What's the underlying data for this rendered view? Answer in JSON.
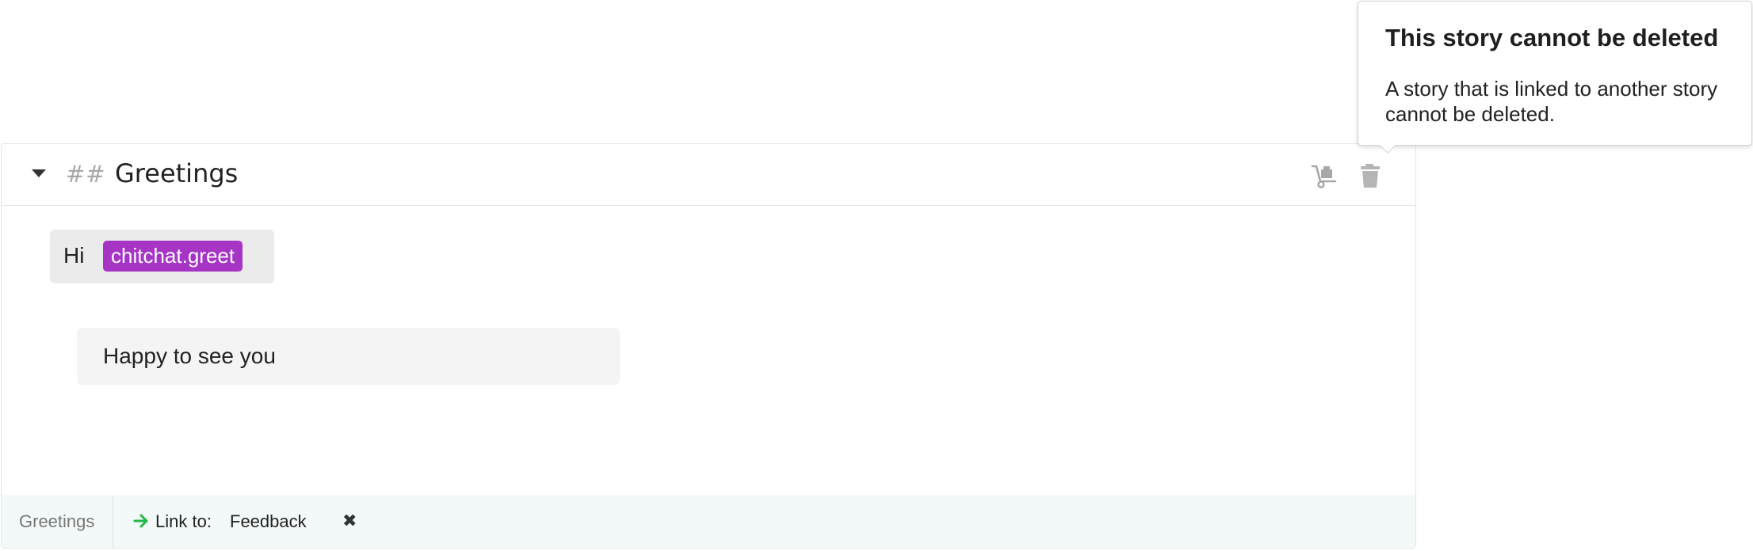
{
  "story": {
    "heading_marker": "##",
    "title": "Greetings",
    "icons": {
      "move": "hand-truck-icon",
      "delete": "trash-icon",
      "collapse": "caret-down-icon"
    },
    "user_message": {
      "text": "Hi",
      "intent": "chitchat.greet"
    },
    "bot_response": {
      "text": "Happy to see you"
    }
  },
  "footer": {
    "story_name": "Greetings",
    "link_label": "Link to:",
    "link_target": "Feedback",
    "remove_glyph": "✖"
  },
  "popup": {
    "title": "This story cannot be deleted",
    "body": "A story that is linked to another story cannot be deleted."
  },
  "colors": {
    "intent_tag": "#a635c6",
    "footer_background": "#f3f8f8",
    "link_arrow": "#21ba45",
    "icon_gray": "#a8a8a8"
  }
}
